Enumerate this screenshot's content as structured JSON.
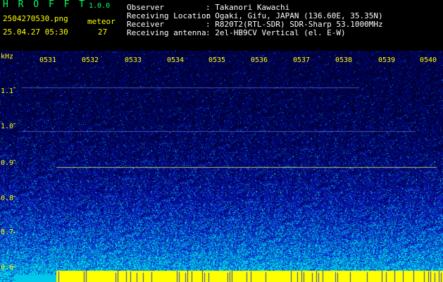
{
  "app": {
    "brand": "H R O F F T",
    "version": "1.0.0",
    "filename": "2504270530.png",
    "timestamp": "25.04.27 05:30",
    "meteor_label": "meteor",
    "meteor_count": "27"
  },
  "info": {
    "observer_label": "Observer",
    "observer_value": ": Takanori Kawachi",
    "location_label": "Receiving Location",
    "location_value": ": Ogaki, Gifu, JAPAN (136.60E, 35.35N)",
    "receiver_label": "Receiver",
    "receiver_value": ": R820T2(RTL-SDR) SDR-Sharp 53.1000MHz",
    "antenna_label": "Receiving antenna",
    "antenna_value": ": 2el-HB9CV Vertical (el. E-W)"
  },
  "axes": {
    "y_unit": "kHz",
    "y_ticks": [
      "1.1",
      "1.0",
      "0.9",
      "0.8",
      "0.7",
      "0.6"
    ],
    "x_ticks": [
      "0531",
      "0532",
      "0533",
      "0534",
      "0535",
      "0536",
      "0537",
      "0538",
      "0539",
      "0540"
    ]
  },
  "colors": {
    "background": "#000000",
    "noise_low": "#000040",
    "noise_mid": "#1a2acc",
    "noise_high": "#00e0e0",
    "saturation": "#ffff00",
    "label": "#ffff00",
    "accent": "#00ff66"
  }
}
